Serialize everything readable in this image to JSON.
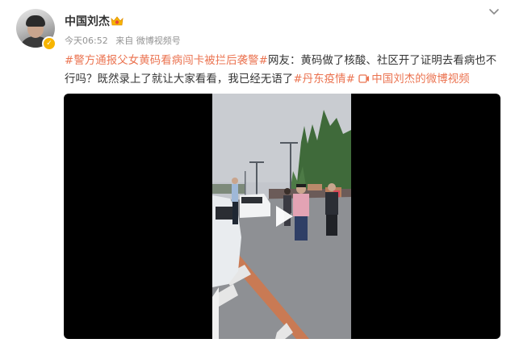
{
  "user": {
    "name": "中国刘杰",
    "avatar_icon": "user-avatar",
    "verified_icon": "verified-badge-icon",
    "member_icon": "vip-member-icon"
  },
  "meta": {
    "time": "今天06:52",
    "source_prefix": "来自",
    "source": "微博视频号"
  },
  "post": {
    "tag_1": "#警方通报父女黄码看病闯卡被拦后袭警#",
    "text_1": "网友：黄码做了核酸、社区开了证明去看病也不行吗？既然录上了就让大家看看，我已经无语了",
    "tag_2": "#丹东疫情#",
    "video_link_icon": "video-link-icon",
    "video_link": "中国刘杰的微博视频"
  },
  "video": {
    "play_icon": "play-icon"
  },
  "colors": {
    "link": "#eb7350",
    "text": "#333333",
    "meta": "#939393",
    "verified": "#f7b500"
  }
}
